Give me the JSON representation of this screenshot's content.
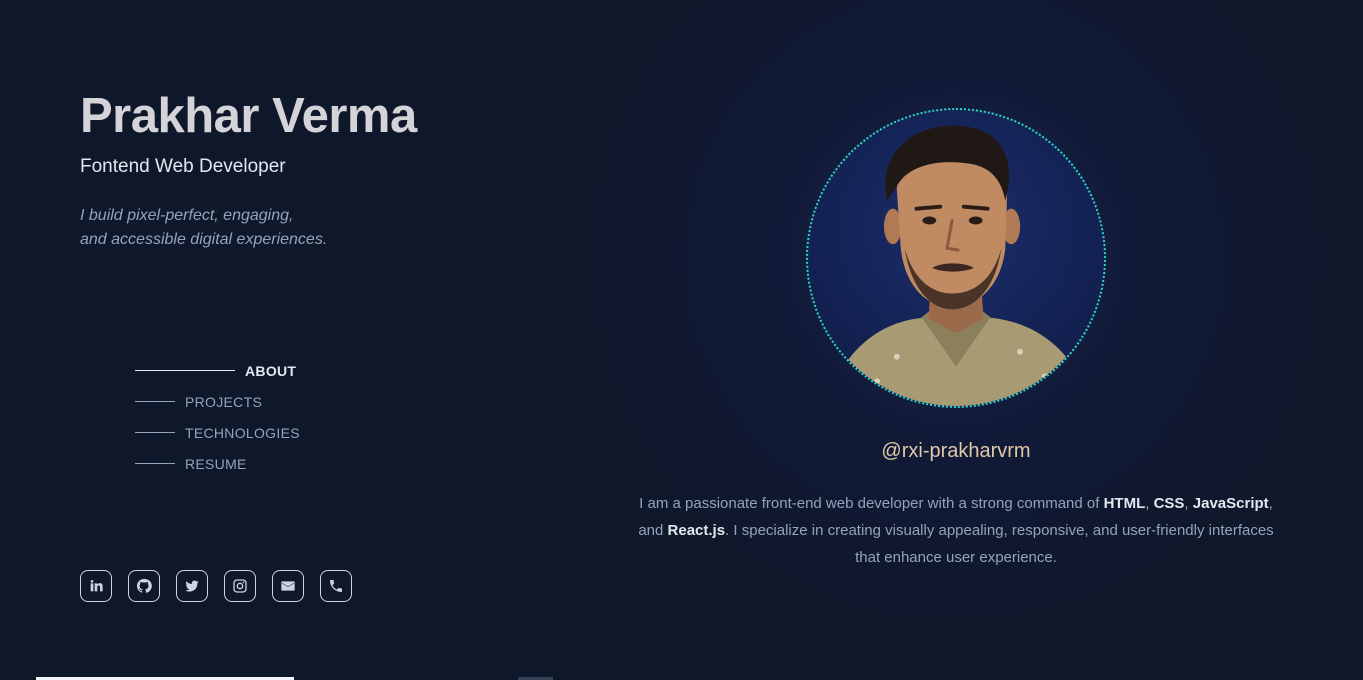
{
  "profile": {
    "name": "Prakhar Verma",
    "role": "Fontend Web Developer",
    "tagline_line1": "I build pixel-perfect, engaging,",
    "tagline_line2": "and accessible digital experiences.",
    "handle": "@rxi-prakharvrm"
  },
  "nav": {
    "items": [
      {
        "label": "ABOUT",
        "active": true
      },
      {
        "label": "PROJECTS",
        "active": false
      },
      {
        "label": "TECHNOLOGIES",
        "active": false
      },
      {
        "label": "RESUME",
        "active": false
      }
    ]
  },
  "socials": [
    {
      "icon": "linkedin-icon"
    },
    {
      "icon": "github-icon"
    },
    {
      "icon": "twitter-icon"
    },
    {
      "icon": "instagram-icon"
    },
    {
      "icon": "mail-icon"
    },
    {
      "icon": "phone-icon"
    }
  ],
  "bio": {
    "p1": "I am a passionate front-end web developer with a strong command of ",
    "t1": "HTML",
    "p2": ", ",
    "t2": "CSS",
    "p3": ", ",
    "t3": "JavaScript",
    "p4": ", and ",
    "t4": "React.js",
    "p5": ". I specialize in creating visually appealing, responsive, and user-friendly interfaces that enhance user experience."
  },
  "colors": {
    "background": "#0f172a",
    "accent_ring": "#2dd4bf",
    "handle": "#e0c9a6",
    "text_primary": "#e2e8f0",
    "text_muted": "#94a3b8"
  }
}
